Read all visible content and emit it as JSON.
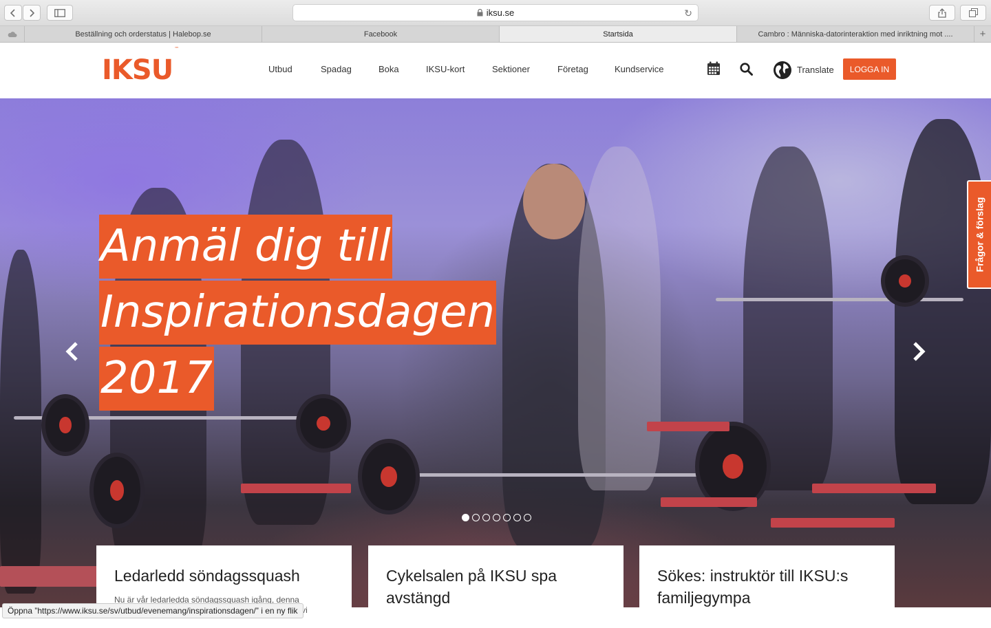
{
  "browser": {
    "url": "iksu.se",
    "tabs": [
      {
        "label": "Beställning och orderstatus | Halebop.se",
        "active": false
      },
      {
        "label": "Facebook",
        "active": false
      },
      {
        "label": "Startsida",
        "active": true
      },
      {
        "label": "Cambro : Människa-datorinteraktion med inriktning mot ....",
        "active": false
      }
    ],
    "status_text": "Öppna ”https://www.iksu.se/sv/utbud/evenemang/inspirationsdagen/” i en ny flik"
  },
  "header": {
    "logo": "IKSU",
    "logo_tm": "™",
    "nav": [
      "Utbud",
      "Spadag",
      "Boka",
      "IKSU-kort",
      "Sektioner",
      "Företag",
      "Kundservice"
    ],
    "translate": "Translate",
    "login": "LOGGA IN"
  },
  "hero": {
    "headline_lines": [
      "Anmäl dig till",
      "Inspirationsdagen",
      "2017"
    ],
    "slide_count": 7,
    "active_slide": 0,
    "prev_icon": "chevron-left-icon",
    "next_icon": "chevron-right-icon"
  },
  "feedback_tab": "Frågor & förslag",
  "cards": [
    {
      "title": "Ledarledd söndagssquash",
      "excerpt": "Nu är vår ledarledda söndagssquash igång, denna termin också med bokningsbara pass för tider som vi"
    },
    {
      "title": "Cykelsalen på IKSU spa avstängd",
      "excerpt": ""
    },
    {
      "title": "Sökes: instruktör till IKSU:s familjegympa",
      "excerpt": ""
    }
  ],
  "colors": {
    "brand": "#ea5a2a",
    "text": "#333333"
  }
}
